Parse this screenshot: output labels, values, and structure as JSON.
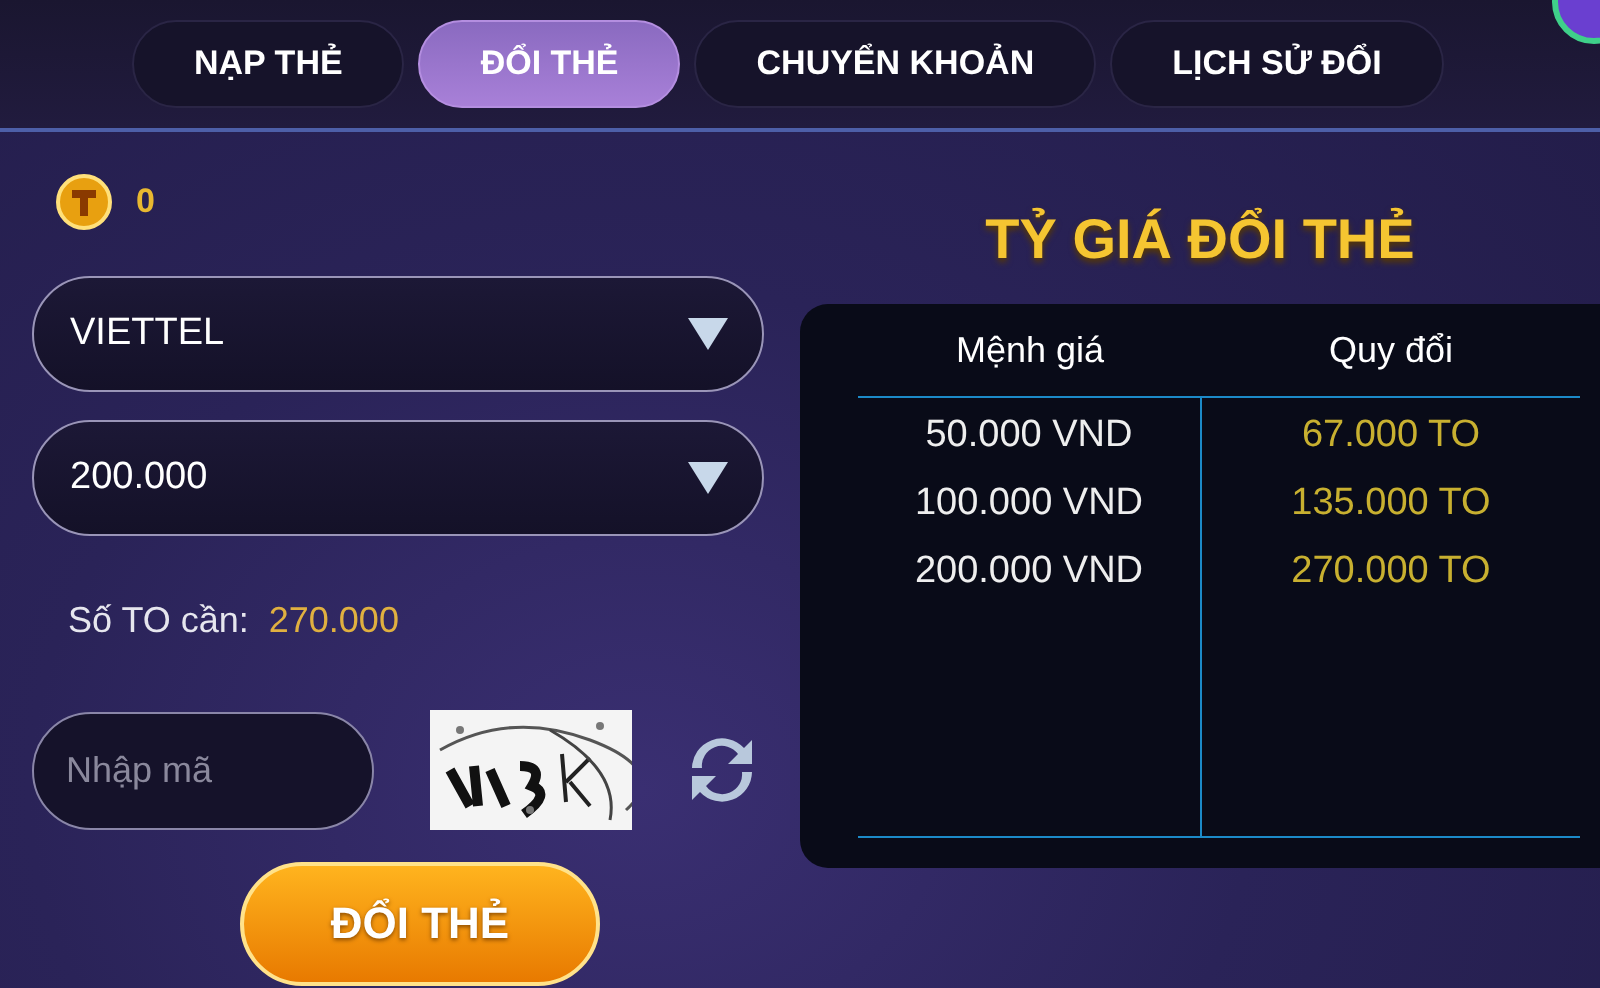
{
  "tabs": [
    {
      "label": "NẠP THẺ",
      "selected": false
    },
    {
      "label": "ĐỔI THẺ",
      "selected": true
    },
    {
      "label": "CHUYỂN KHOẢN",
      "selected": false
    },
    {
      "label": "LỊCH SỬ ĐỔI",
      "selected": false
    }
  ],
  "balance": {
    "value": "0"
  },
  "selects": [
    {
      "value": "VIETTEL"
    },
    {
      "value": "200.000"
    }
  ],
  "required": {
    "label": "Số TO cần:",
    "value": "270.000"
  },
  "code_field": {
    "placeholder": "Nhập mã"
  },
  "submit_button": "ĐỔI THẺ",
  "rates": {
    "title": "TỶ GIÁ ĐỔI THẺ",
    "columns": [
      "Mệnh giá",
      "Quy đổi"
    ],
    "rows": [
      {
        "value": "50.000 VND",
        "converted": "67.000 TO"
      },
      {
        "value": "100.000 VND",
        "converted": "135.000 TO"
      },
      {
        "value": "200.000 VND",
        "converted": "270.000 TO"
      }
    ]
  }
}
